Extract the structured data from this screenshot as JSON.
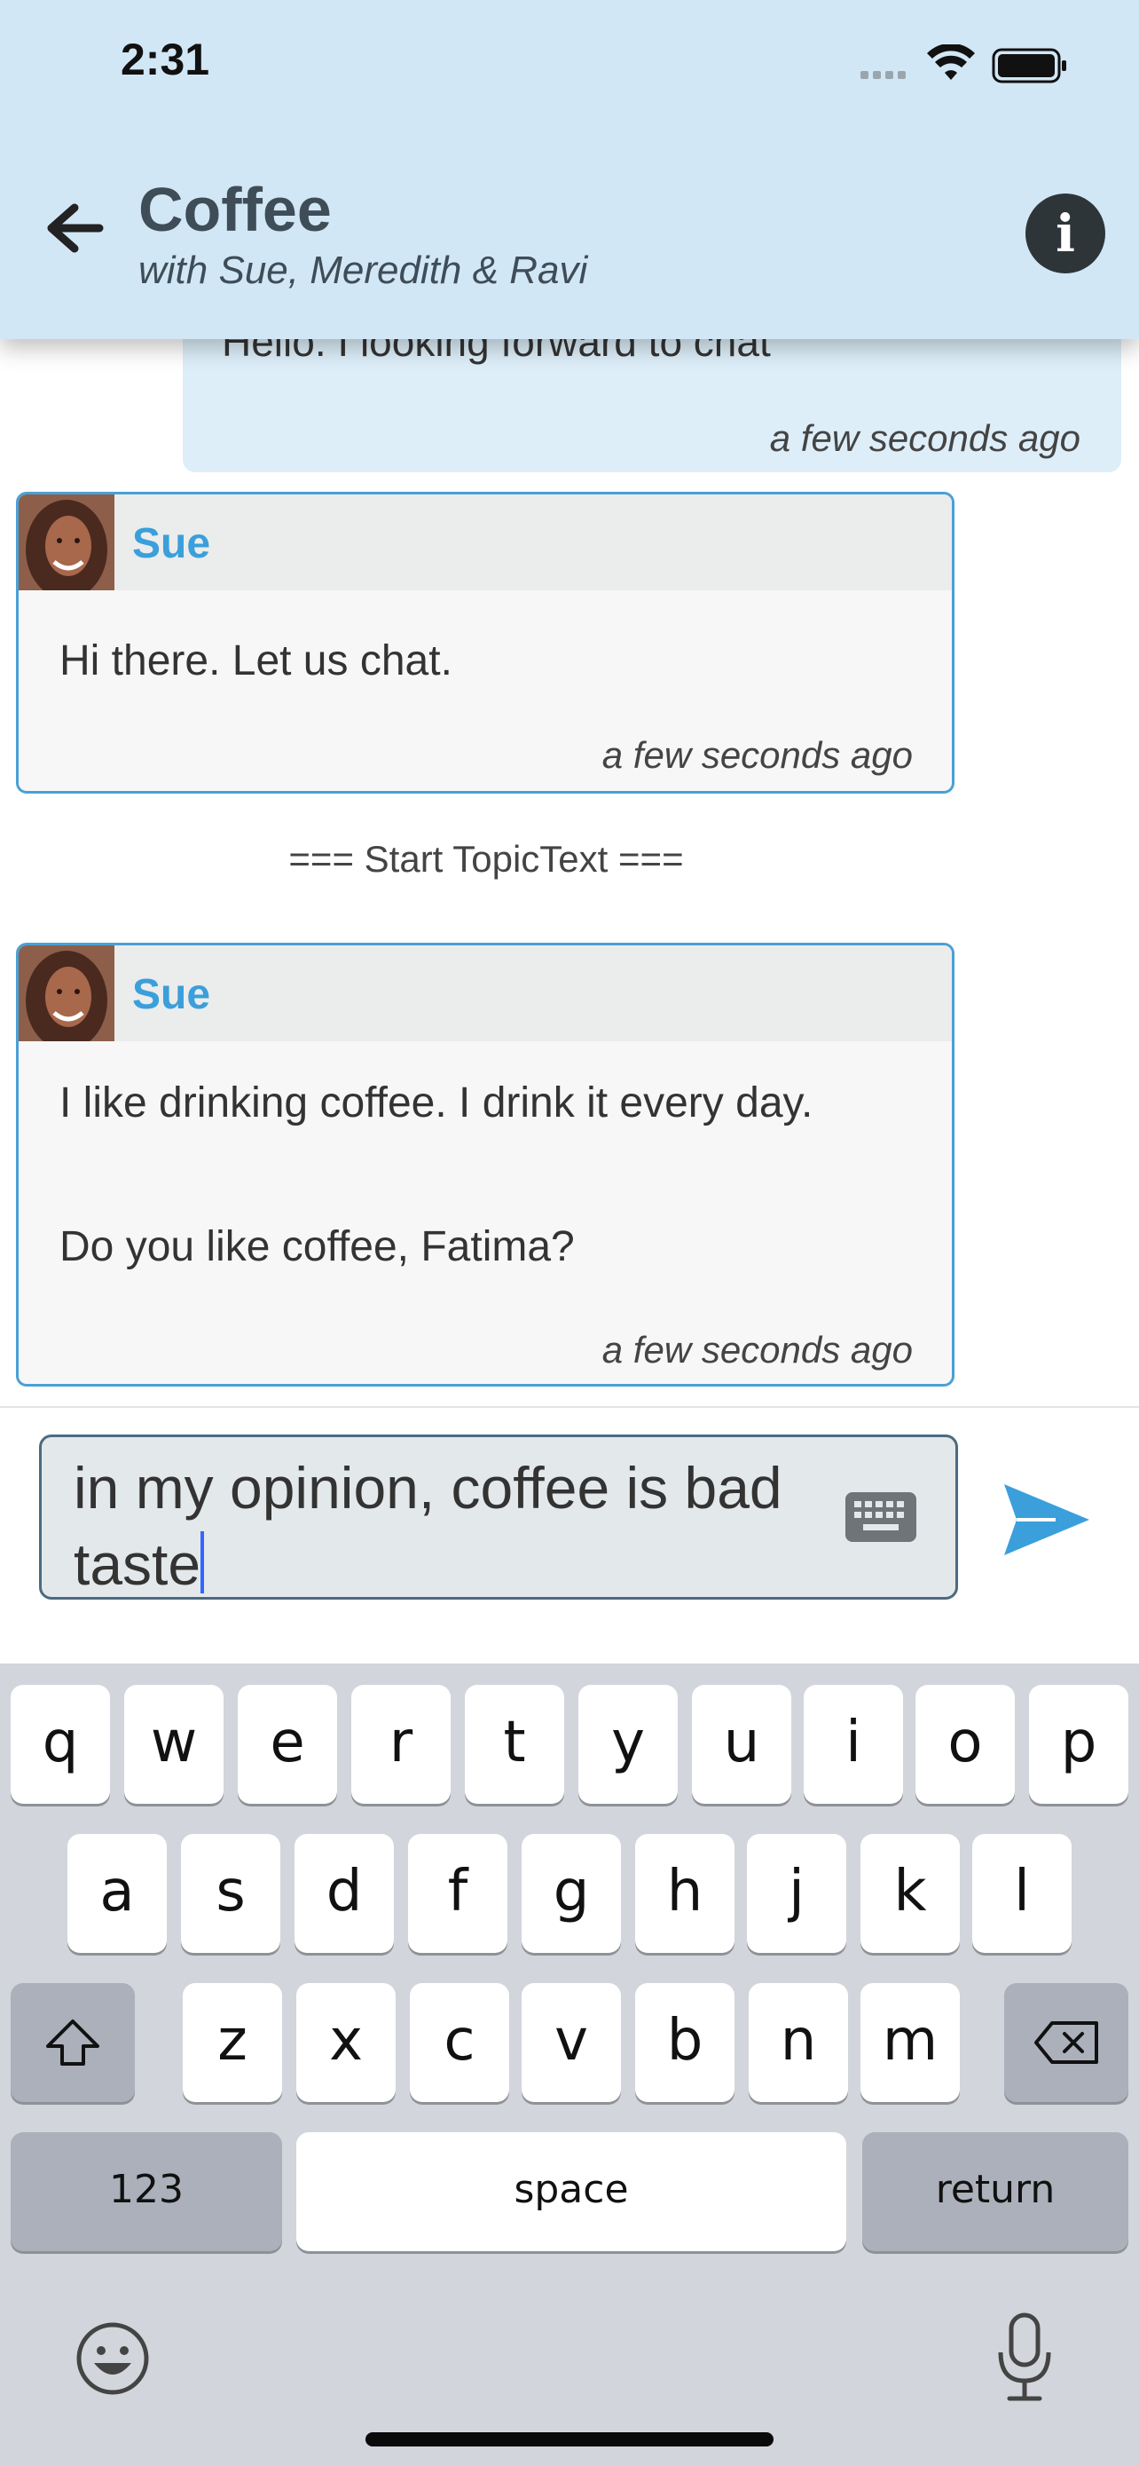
{
  "status_bar": {
    "time": "2:31"
  },
  "header": {
    "title": "Coffee",
    "subtitle": "with Sue, Meredith & Ravi"
  },
  "messages": {
    "own": {
      "text": "Hello. I looking forward to chat",
      "time": "a few seconds ago"
    },
    "m1": {
      "sender": "Sue",
      "lines": [
        "Hi there. Let us chat."
      ],
      "time": "a few seconds ago"
    },
    "divider": "=== Start TopicText ===",
    "m2": {
      "sender": "Sue",
      "lines": [
        "I like drinking coffee. I drink it every day.",
        "Do you like coffee, Fatima?"
      ],
      "time": "a few seconds ago"
    }
  },
  "composer": {
    "value": "in my opinion, coffee is bad taste"
  },
  "keyboard": {
    "row1": [
      "q",
      "w",
      "e",
      "r",
      "t",
      "y",
      "u",
      "i",
      "o",
      "p"
    ],
    "row2": [
      "a",
      "s",
      "d",
      "f",
      "g",
      "h",
      "j",
      "k",
      "l"
    ],
    "row3": [
      "z",
      "x",
      "c",
      "v",
      "b",
      "n",
      "m"
    ],
    "numbers_label": "123",
    "space_label": "space",
    "return_label": "return"
  },
  "colors": {
    "header_bg": "#d2e7f5",
    "accent": "#3a9fdb",
    "card_border": "#4aa0d5",
    "send": "#3a9fdb"
  }
}
